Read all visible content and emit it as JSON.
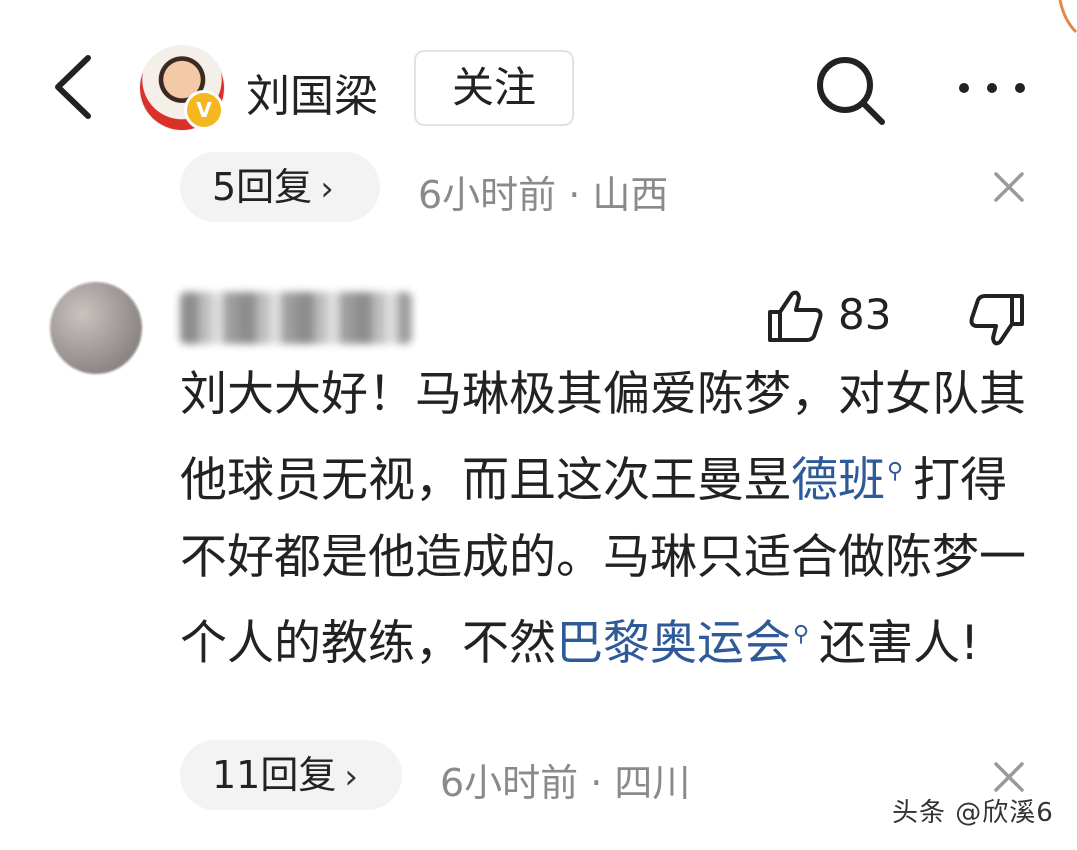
{
  "header": {
    "author_name": "刘国梁",
    "follow_label": "关注",
    "verified_badge": "V"
  },
  "comment_1_footer": {
    "reply_label": "5回复",
    "time_location": "6小时前 · 山西"
  },
  "comment_2": {
    "like_count": "83",
    "body": {
      "part_1": "刘大大好！马琳极其偏爱陈梦，对女队其他球员无视，而且这次王曼昱",
      "link_1": "德班",
      "part_2": "打得不好都是他造成的。马琳只适合做陈梦一个人的教练，不然",
      "link_2": "巴黎奥运会",
      "part_3": "还害人!"
    },
    "reply_label": "11回复",
    "time_location": "6小时前 · 四川"
  },
  "watermark": "头条 @欣溪6",
  "colors": {
    "link": "#2f5a9a",
    "meta_gray": "#8a8a8a",
    "pill_bg": "#f3f3f3",
    "badge": "#f4b71f"
  },
  "icons": [
    "back-arrow-icon",
    "search-icon",
    "more-icon",
    "close-icon",
    "thumbs-up-icon",
    "thumbs-down-icon",
    "search-small-icon"
  ]
}
